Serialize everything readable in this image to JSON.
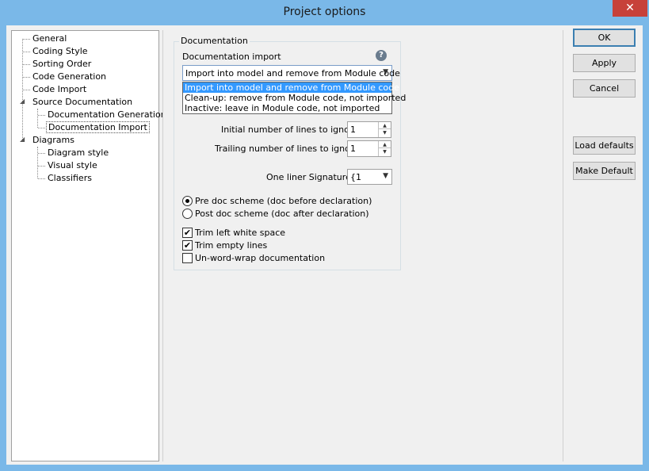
{
  "window": {
    "title": "Project options",
    "close_label": "✕"
  },
  "tree": {
    "items": [
      {
        "label": "General"
      },
      {
        "label": "Coding Style"
      },
      {
        "label": "Sorting Order"
      },
      {
        "label": "Code Generation"
      },
      {
        "label": "Code Import"
      },
      {
        "label": "Source Documentation"
      },
      {
        "label": "Documentation Generation"
      },
      {
        "label": "Documentation Import"
      },
      {
        "label": "Diagrams"
      },
      {
        "label": "Diagram style"
      },
      {
        "label": "Visual style"
      },
      {
        "label": "Classifiers"
      }
    ]
  },
  "panel": {
    "group_title": "Documentation",
    "doc_import_label": "Documentation import",
    "doc_import_value": "Import into model and remove from Module code",
    "doc_import_options": [
      "Import into model and remove from Module code",
      "Clean-up: remove from Module code, not imported",
      "Inactive: leave in Module code, not imported"
    ],
    "initial_lines_label": "Initial number of lines to ignore",
    "initial_lines_value": "1",
    "trailing_lines_label": "Trailing number of lines to ignore",
    "trailing_lines_value": "1",
    "one_liner_label": "One liner Signature",
    "one_liner_value": "{1",
    "pre_doc_label": "Pre doc scheme (doc before declaration)",
    "post_doc_label": "Post doc scheme (doc after declaration)",
    "trim_left_label": "Trim left white space",
    "trim_empty_label": "Trim empty lines",
    "unwrap_label": "Un-word-wrap documentation"
  },
  "buttons": {
    "ok": "OK",
    "apply": "Apply",
    "cancel": "Cancel",
    "load_defaults": "Load defaults",
    "make_default": "Make Default"
  },
  "icons": {
    "help": "?",
    "check": "✔",
    "chevron": "⌄"
  }
}
